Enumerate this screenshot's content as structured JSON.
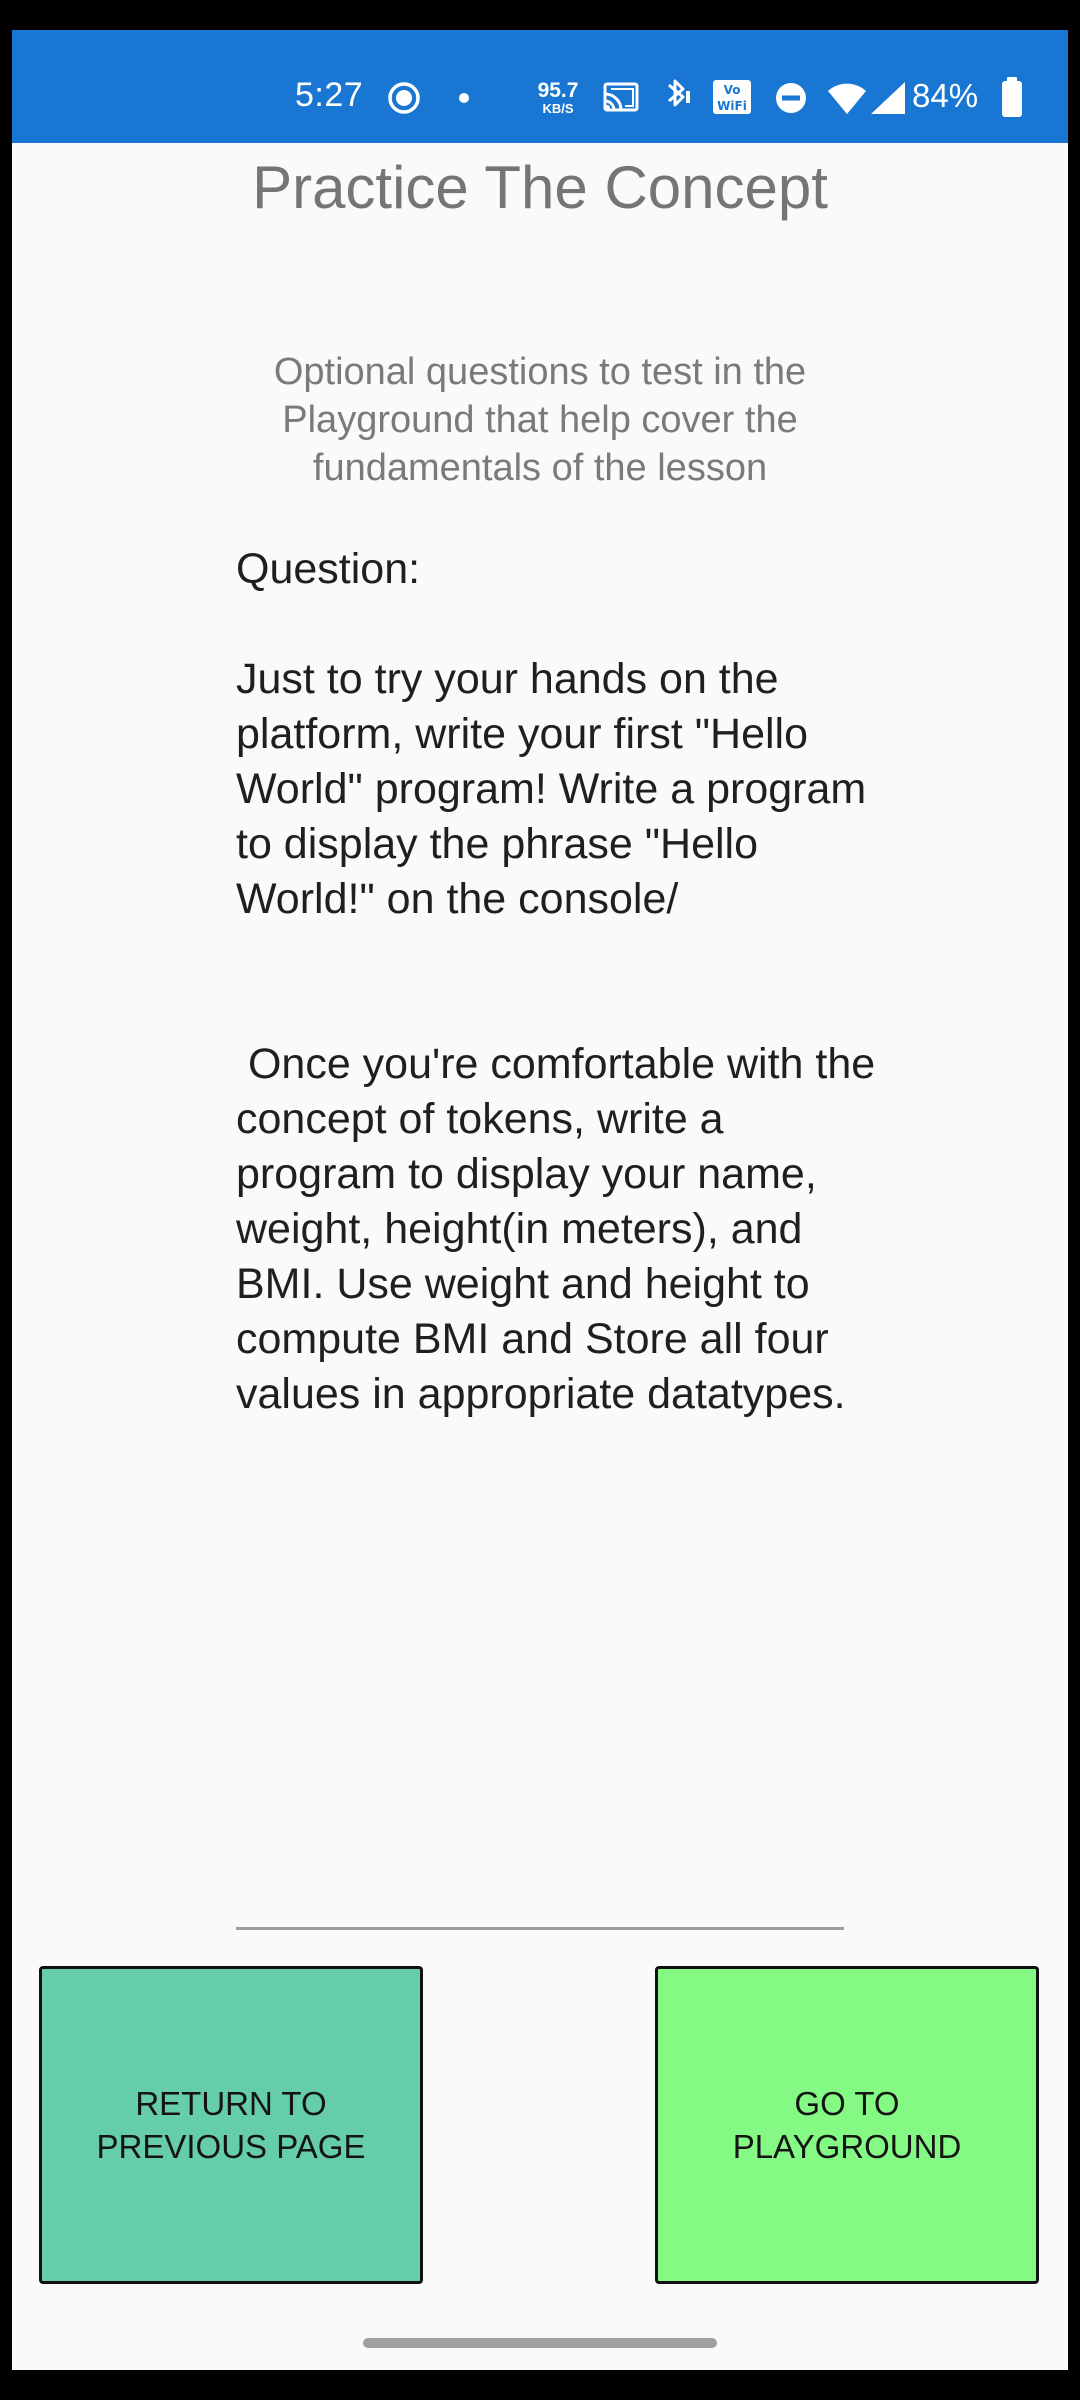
{
  "status_bar": {
    "time": "5:27",
    "net_speed_value": "95.7",
    "net_speed_unit": "KB/S",
    "battery_percent": "84%",
    "icons": [
      "record-icon",
      "dot-icon",
      "cast-icon",
      "bluetooth-icon",
      "vowifi-icon",
      "dnd-icon",
      "wifi-icon",
      "signal-icon",
      "battery-icon"
    ],
    "background_color": "#1976d2"
  },
  "page": {
    "title": "Practice The Concept",
    "subtitle": "Optional questions to test in the Playground that help cover the fundamentals of the lesson",
    "question_text": "Question:\n\nJust to try your hands on the platform, write your first \"Hello World\" program! Write a program to display the phrase \"Hello World!\" on the console/\n\n\n Once you're comfortable with the concept of tokens, write a program to display your name, weight, height(in meters), and BMI. Use weight and height to compute BMI and Store all four values in appropriate datatypes."
  },
  "buttons": {
    "return_label": "RETURN TO\nPREVIOUS PAGE",
    "playground_label": "GO TO\nPLAYGROUND",
    "return_color": "#66cdaa",
    "playground_color": "#84fa84"
  }
}
